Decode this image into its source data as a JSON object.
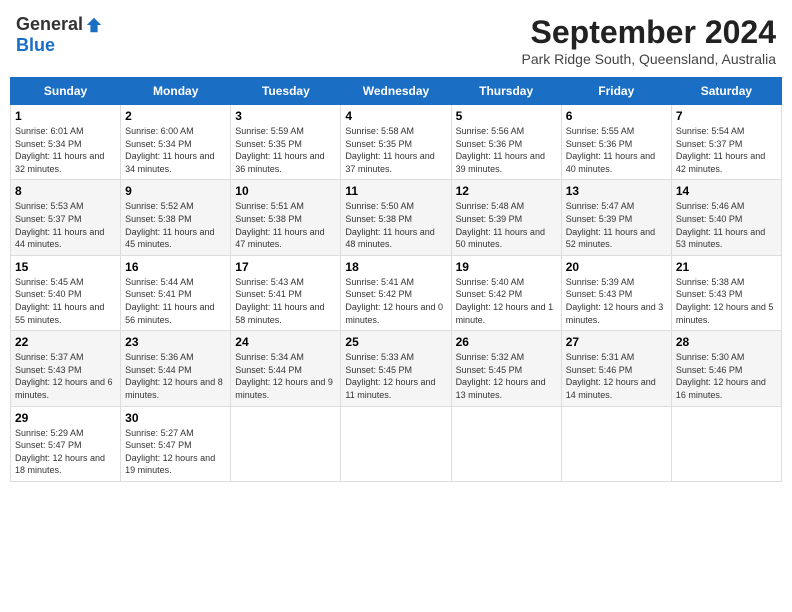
{
  "header": {
    "logo_general": "General",
    "logo_blue": "Blue",
    "month_title": "September 2024",
    "location": "Park Ridge South, Queensland, Australia"
  },
  "weekdays": [
    "Sunday",
    "Monday",
    "Tuesday",
    "Wednesday",
    "Thursday",
    "Friday",
    "Saturday"
  ],
  "weeks": [
    [
      {
        "day": "1",
        "sunrise": "6:01 AM",
        "sunset": "5:34 PM",
        "daylight": "11 hours and 32 minutes."
      },
      {
        "day": "2",
        "sunrise": "6:00 AM",
        "sunset": "5:34 PM",
        "daylight": "11 hours and 34 minutes."
      },
      {
        "day": "3",
        "sunrise": "5:59 AM",
        "sunset": "5:35 PM",
        "daylight": "11 hours and 36 minutes."
      },
      {
        "day": "4",
        "sunrise": "5:58 AM",
        "sunset": "5:35 PM",
        "daylight": "11 hours and 37 minutes."
      },
      {
        "day": "5",
        "sunrise": "5:56 AM",
        "sunset": "5:36 PM",
        "daylight": "11 hours and 39 minutes."
      },
      {
        "day": "6",
        "sunrise": "5:55 AM",
        "sunset": "5:36 PM",
        "daylight": "11 hours and 40 minutes."
      },
      {
        "day": "7",
        "sunrise": "5:54 AM",
        "sunset": "5:37 PM",
        "daylight": "11 hours and 42 minutes."
      }
    ],
    [
      {
        "day": "8",
        "sunrise": "5:53 AM",
        "sunset": "5:37 PM",
        "daylight": "11 hours and 44 minutes."
      },
      {
        "day": "9",
        "sunrise": "5:52 AM",
        "sunset": "5:38 PM",
        "daylight": "11 hours and 45 minutes."
      },
      {
        "day": "10",
        "sunrise": "5:51 AM",
        "sunset": "5:38 PM",
        "daylight": "11 hours and 47 minutes."
      },
      {
        "day": "11",
        "sunrise": "5:50 AM",
        "sunset": "5:38 PM",
        "daylight": "11 hours and 48 minutes."
      },
      {
        "day": "12",
        "sunrise": "5:48 AM",
        "sunset": "5:39 PM",
        "daylight": "11 hours and 50 minutes."
      },
      {
        "day": "13",
        "sunrise": "5:47 AM",
        "sunset": "5:39 PM",
        "daylight": "11 hours and 52 minutes."
      },
      {
        "day": "14",
        "sunrise": "5:46 AM",
        "sunset": "5:40 PM",
        "daylight": "11 hours and 53 minutes."
      }
    ],
    [
      {
        "day": "15",
        "sunrise": "5:45 AM",
        "sunset": "5:40 PM",
        "daylight": "11 hours and 55 minutes."
      },
      {
        "day": "16",
        "sunrise": "5:44 AM",
        "sunset": "5:41 PM",
        "daylight": "11 hours and 56 minutes."
      },
      {
        "day": "17",
        "sunrise": "5:43 AM",
        "sunset": "5:41 PM",
        "daylight": "11 hours and 58 minutes."
      },
      {
        "day": "18",
        "sunrise": "5:41 AM",
        "sunset": "5:42 PM",
        "daylight": "12 hours and 0 minutes."
      },
      {
        "day": "19",
        "sunrise": "5:40 AM",
        "sunset": "5:42 PM",
        "daylight": "12 hours and 1 minute."
      },
      {
        "day": "20",
        "sunrise": "5:39 AM",
        "sunset": "5:43 PM",
        "daylight": "12 hours and 3 minutes."
      },
      {
        "day": "21",
        "sunrise": "5:38 AM",
        "sunset": "5:43 PM",
        "daylight": "12 hours and 5 minutes."
      }
    ],
    [
      {
        "day": "22",
        "sunrise": "5:37 AM",
        "sunset": "5:43 PM",
        "daylight": "12 hours and 6 minutes."
      },
      {
        "day": "23",
        "sunrise": "5:36 AM",
        "sunset": "5:44 PM",
        "daylight": "12 hours and 8 minutes."
      },
      {
        "day": "24",
        "sunrise": "5:34 AM",
        "sunset": "5:44 PM",
        "daylight": "12 hours and 9 minutes."
      },
      {
        "day": "25",
        "sunrise": "5:33 AM",
        "sunset": "5:45 PM",
        "daylight": "12 hours and 11 minutes."
      },
      {
        "day": "26",
        "sunrise": "5:32 AM",
        "sunset": "5:45 PM",
        "daylight": "12 hours and 13 minutes."
      },
      {
        "day": "27",
        "sunrise": "5:31 AM",
        "sunset": "5:46 PM",
        "daylight": "12 hours and 14 minutes."
      },
      {
        "day": "28",
        "sunrise": "5:30 AM",
        "sunset": "5:46 PM",
        "daylight": "12 hours and 16 minutes."
      }
    ],
    [
      {
        "day": "29",
        "sunrise": "5:29 AM",
        "sunset": "5:47 PM",
        "daylight": "12 hours and 18 minutes."
      },
      {
        "day": "30",
        "sunrise": "5:27 AM",
        "sunset": "5:47 PM",
        "daylight": "12 hours and 19 minutes."
      },
      null,
      null,
      null,
      null,
      null
    ]
  ]
}
